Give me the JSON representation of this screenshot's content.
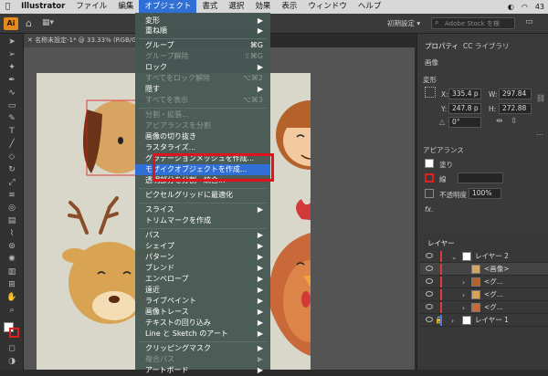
{
  "menubar": {
    "apple": "",
    "app_name": "Illustrator",
    "items": [
      "ファイル",
      "編集",
      "オブジェクト",
      "書式",
      "選択",
      "効果",
      "表示",
      "ウィンドウ",
      "ヘルプ"
    ],
    "clock": "43"
  },
  "appbar": {
    "workspace": "初期設定",
    "stock_search_placeholder": "Adobe Stock を検"
  },
  "document_tab": "名称未設定-1* @ 33.33% (RGB/GPU",
  "object_menu": [
    {
      "label": "変形",
      "submenu": true
    },
    {
      "label": "重ね順",
      "submenu": true
    },
    {
      "label": "グループ",
      "shortcut": "⌘G"
    },
    {
      "label": "グループ解除",
      "shortcut": "⇧⌘G",
      "disabled": true
    },
    {
      "label": "ロック",
      "submenu": true
    },
    {
      "label": "すべてをロック解除",
      "shortcut": "⌥⌘2",
      "disabled": true
    },
    {
      "label": "隠す",
      "submenu": true
    },
    {
      "label": "すべてを表示",
      "shortcut": "⌥⌘3",
      "disabled": true
    },
    {
      "label": "分割・拡張...",
      "disabled": true
    },
    {
      "label": "アピアランスを分割",
      "disabled": true
    },
    {
      "label": "画像の切り抜き"
    },
    {
      "label": "ラスタライズ..."
    },
    {
      "label": "グラデーションメッシュを作成..."
    },
    {
      "label": "モザイクオブジェクトを作成...",
      "highlighted": true
    },
    {
      "label": "透明部分を分割・統合..."
    },
    {
      "label": "ピクセルグリッドに最適化"
    },
    {
      "label": "スライス",
      "submenu": true
    },
    {
      "label": "トリムマークを作成"
    },
    {
      "label": "パス",
      "submenu": true
    },
    {
      "label": "シェイプ",
      "submenu": true
    },
    {
      "label": "パターン",
      "submenu": true
    },
    {
      "label": "ブレンド",
      "submenu": true
    },
    {
      "label": "エンベロープ",
      "submenu": true
    },
    {
      "label": "遠近",
      "submenu": true
    },
    {
      "label": "ライブペイント",
      "submenu": true
    },
    {
      "label": "画像トレース",
      "submenu": true
    },
    {
      "label": "テキストの回り込み",
      "submenu": true
    },
    {
      "label": "Line と Sketch のアート",
      "submenu": true
    },
    {
      "label": "クリッピングマスク",
      "submenu": true
    },
    {
      "label": "複合パス",
      "submenu": true,
      "disabled": true
    },
    {
      "label": "アートボード",
      "submenu": true
    }
  ],
  "properties_panel": {
    "tabs": [
      "プロパティ",
      "CC ライブラリ"
    ],
    "selection_type": "画像",
    "transform_label": "変形",
    "x_label": "X:",
    "x_value": "335.4 p",
    "y_label": "Y:",
    "y_value": "247.8 p",
    "w_label": "W:",
    "w_value": "297.84",
    "h_label": "H:",
    "h_value": "272.88",
    "rotation_value": "0°",
    "appearance_label": "アピアランス",
    "fill_label": "塗り",
    "stroke_label": "線",
    "opacity_label": "不透明度",
    "opacity_value": "100%",
    "fx_label": "fx."
  },
  "layers_panel": {
    "title": "レイヤー",
    "rows": [
      "レイヤー 2",
      "<画像>",
      "<グ...",
      "<グ...",
      "<グ...",
      "レイヤー 1"
    ]
  },
  "colors": {
    "menu_highlight": "#2f6fd6",
    "annotation_box": "#e0141a",
    "artboard": "#d9d7ca"
  }
}
